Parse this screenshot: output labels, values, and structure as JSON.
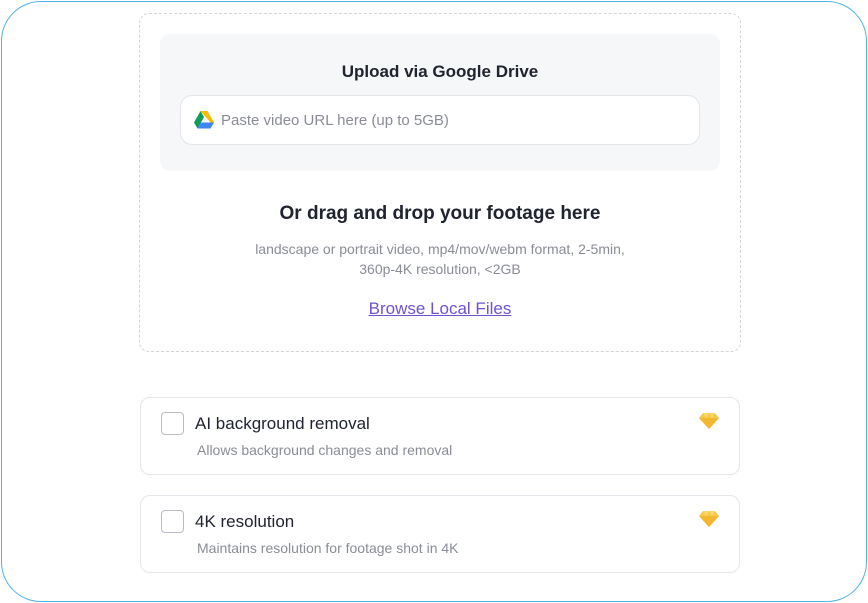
{
  "upload": {
    "gdrive_title": "Upload via Google Drive",
    "url_placeholder": "Paste video URL here (up to 5GB)",
    "url_value": "",
    "drop_heading": "Or drag and drop your footage here",
    "drop_desc_line1": "landscape or portrait video, mp4/mov/webm format, 2-5min,",
    "drop_desc_line2": "360p-4K resolution, <2GB",
    "browse_label": "Browse Local Files"
  },
  "options": [
    {
      "title": "AI background removal",
      "description": "Allows background changes and removal",
      "checked": false,
      "icon": "premium-gem-icon"
    },
    {
      "title": "4K resolution",
      "description": "Maintains resolution for footage shot in 4K",
      "checked": false,
      "icon": "premium-gem-icon"
    }
  ],
  "colors": {
    "frame_border": "#4fb3e6",
    "link": "#6e52d6",
    "gem": "#f7c94a",
    "muted_text": "#8a8d96"
  }
}
